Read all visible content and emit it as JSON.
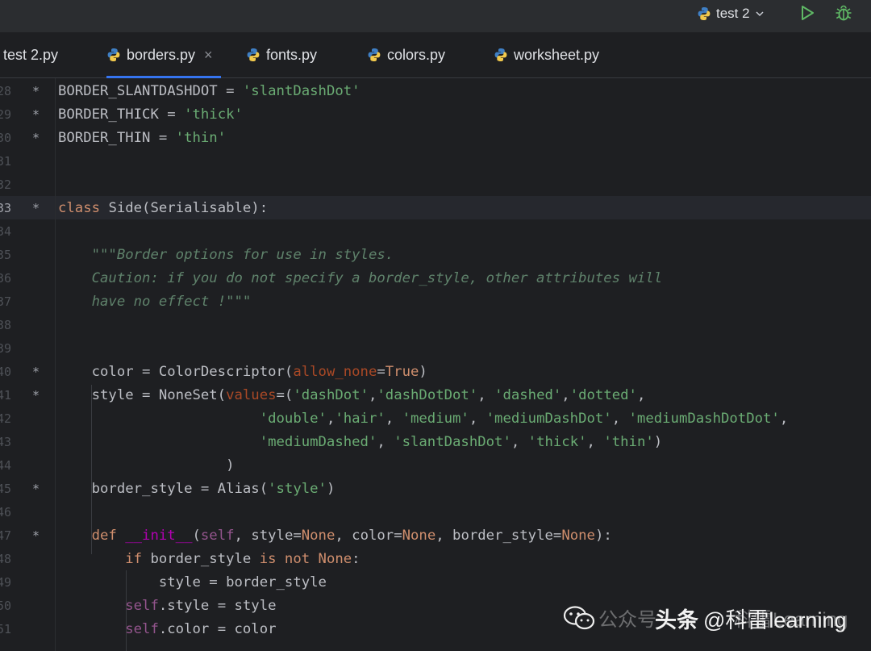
{
  "toolbar": {
    "run_config": "test 2",
    "icons": [
      "python-icon",
      "chevron-down-icon",
      "run-icon",
      "debug-icon"
    ],
    "colors": {
      "run": "#5fb865",
      "debug": "#5fb865"
    }
  },
  "tabs": [
    {
      "label": "test 2.py",
      "active": false
    },
    {
      "label": "borders.py",
      "active": true
    },
    {
      "label": "fonts.py",
      "active": false
    },
    {
      "label": "colors.py",
      "active": false
    },
    {
      "label": "worksheet.py",
      "active": false
    }
  ],
  "tab_close": "×",
  "lines": [
    {
      "num": "28",
      "star": "*",
      "parts": [
        [
          "t",
          "BORDER_SLANTDASHDOT = "
        ],
        [
          "str",
          "'slantDashDot'"
        ]
      ]
    },
    {
      "num": "29",
      "star": "*",
      "parts": [
        [
          "t",
          "BORDER_THICK = "
        ],
        [
          "str",
          "'thick'"
        ]
      ]
    },
    {
      "num": "30",
      "star": "*",
      "parts": [
        [
          "t",
          "BORDER_THIN = "
        ],
        [
          "str",
          "'thin'"
        ]
      ]
    },
    {
      "num": "31",
      "star": "",
      "parts": []
    },
    {
      "num": "32",
      "star": "",
      "parts": []
    },
    {
      "num": "33",
      "star": "*",
      "parts": [
        [
          "kw",
          "class "
        ],
        [
          "t",
          "Side(Serialisable):"
        ]
      ]
    },
    {
      "num": "34",
      "star": "",
      "parts": []
    },
    {
      "num": "35",
      "star": "",
      "parts": [
        [
          "t",
          "    "
        ],
        [
          "doc",
          "\"\"\"Border options for use in styles."
        ]
      ]
    },
    {
      "num": "36",
      "star": "",
      "parts": [
        [
          "t",
          "    "
        ],
        [
          "doc",
          "Caution: if you do not specify a border_style, other attributes will"
        ]
      ]
    },
    {
      "num": "37",
      "star": "",
      "parts": [
        [
          "t",
          "    "
        ],
        [
          "doc",
          "have no effect !\"\"\""
        ]
      ]
    },
    {
      "num": "38",
      "star": "",
      "parts": []
    },
    {
      "num": "39",
      "star": "",
      "parts": []
    },
    {
      "num": "40",
      "star": "*",
      "parts": [
        [
          "t",
          "    color = ColorDescriptor("
        ],
        [
          "param",
          "allow_none"
        ],
        [
          "t",
          "="
        ],
        [
          "kw",
          "True"
        ],
        [
          "t",
          ")"
        ]
      ]
    },
    {
      "num": "41",
      "star": "*",
      "parts": [
        [
          "t",
          "    style = NoneSet("
        ],
        [
          "param",
          "values"
        ],
        [
          "t",
          "=("
        ],
        [
          "str",
          "'dashDot'"
        ],
        [
          "t",
          ","
        ],
        [
          "str",
          "'dashDotDot'"
        ],
        [
          "t",
          ", "
        ],
        [
          "str",
          "'dashed'"
        ],
        [
          "t",
          ","
        ],
        [
          "str",
          "'dotted'"
        ],
        [
          "t",
          ","
        ]
      ]
    },
    {
      "num": "42",
      "star": "",
      "parts": [
        [
          "t",
          "                        "
        ],
        [
          "str",
          "'double'"
        ],
        [
          "t",
          ","
        ],
        [
          "str",
          "'hair'"
        ],
        [
          "t",
          ", "
        ],
        [
          "str",
          "'medium'"
        ],
        [
          "t",
          ", "
        ],
        [
          "str",
          "'mediumDashDot'"
        ],
        [
          "t",
          ", "
        ],
        [
          "str",
          "'mediumDashDotDot'"
        ],
        [
          "t",
          ","
        ]
      ]
    },
    {
      "num": "43",
      "star": "",
      "parts": [
        [
          "t",
          "                        "
        ],
        [
          "str",
          "'mediumDashed'"
        ],
        [
          "t",
          ", "
        ],
        [
          "str",
          "'slantDashDot'"
        ],
        [
          "t",
          ", "
        ],
        [
          "str",
          "'thick'"
        ],
        [
          "t",
          ", "
        ],
        [
          "str",
          "'thin'"
        ],
        [
          "t",
          ")"
        ]
      ]
    },
    {
      "num": "44",
      "star": "",
      "parts": [
        [
          "t",
          "                    )"
        ]
      ]
    },
    {
      "num": "45",
      "star": "*",
      "parts": [
        [
          "t",
          "    border_style = Alias("
        ],
        [
          "str",
          "'style'"
        ],
        [
          "t",
          ")"
        ]
      ]
    },
    {
      "num": "46",
      "star": "",
      "parts": []
    },
    {
      "num": "47",
      "star": "*",
      "parts": [
        [
          "t",
          "    "
        ],
        [
          "kw",
          "def "
        ],
        [
          "dunder",
          "__init__"
        ],
        [
          "t",
          "("
        ],
        [
          "self",
          "self"
        ],
        [
          "t",
          ", style="
        ],
        [
          "kw",
          "None"
        ],
        [
          "t",
          ", color="
        ],
        [
          "kw",
          "None"
        ],
        [
          "t",
          ", border_style="
        ],
        [
          "kw",
          "None"
        ],
        [
          "t",
          "):"
        ]
      ]
    },
    {
      "num": "48",
      "star": "",
      "parts": [
        [
          "t",
          "        "
        ],
        [
          "kw",
          "if "
        ],
        [
          "t",
          "border_style "
        ],
        [
          "kw",
          "is not None"
        ],
        [
          "t",
          ":"
        ]
      ]
    },
    {
      "num": "49",
      "star": "",
      "parts": [
        [
          "t",
          "            style = border_style"
        ]
      ]
    },
    {
      "num": "50",
      "star": "",
      "parts": [
        [
          "t",
          "        "
        ],
        [
          "self",
          "self"
        ],
        [
          "t",
          ".style = style"
        ]
      ]
    },
    {
      "num": "51",
      "star": "",
      "parts": [
        [
          "t",
          "        "
        ],
        [
          "self",
          "self"
        ],
        [
          "t",
          ".color = color"
        ]
      ]
    }
  ],
  "current_line": "33",
  "watermark": {
    "prefix": "公众号",
    "brand": "头条",
    "handle": "@科雷learning",
    "faint": "科雷Learning"
  }
}
